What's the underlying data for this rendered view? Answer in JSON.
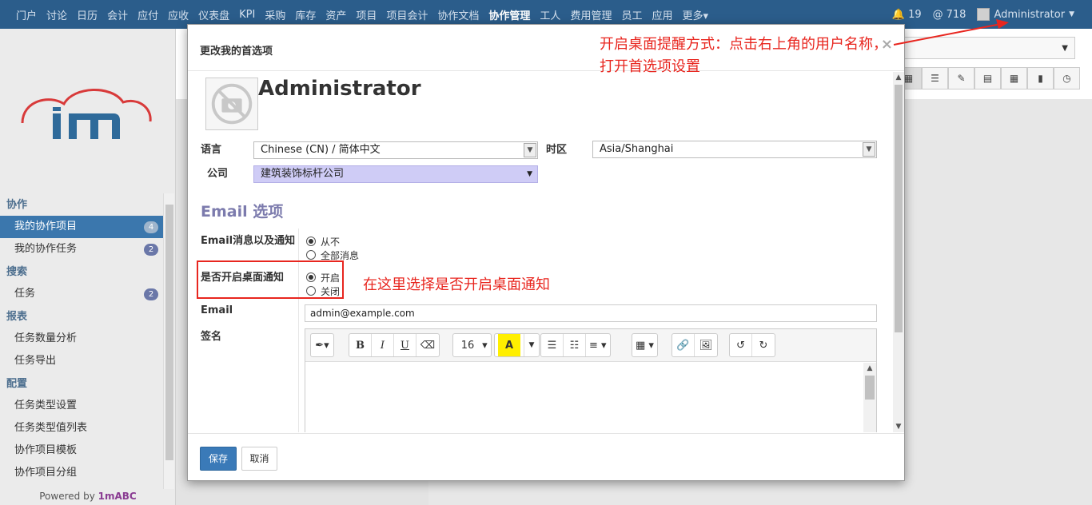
{
  "topnav": {
    "items": [
      "门户",
      "讨论",
      "日历",
      "会计",
      "应付",
      "应收",
      "仪表盘",
      "KPI",
      "采购",
      "库存",
      "资产",
      "项目",
      "项目会计",
      "协作文档",
      "协作管理",
      "工人",
      "费用管理",
      "员工",
      "应用",
      "更多▾"
    ],
    "active_index": 14,
    "notifications": "19",
    "mentions": "718",
    "user": "Administrator",
    "colors": {
      "bar": "#2b5d8b"
    }
  },
  "sidebar": {
    "sections": [
      {
        "title": "协作",
        "items": [
          {
            "label": "我的协作项目",
            "badge": "4",
            "active": true
          },
          {
            "label": "我的协作任务",
            "badge": "2"
          }
        ]
      },
      {
        "title": "搜索",
        "items": [
          {
            "label": "任务",
            "badge": "2"
          }
        ]
      },
      {
        "title": "报表",
        "items": [
          {
            "label": "任务数量分析"
          },
          {
            "label": "任务导出"
          }
        ]
      },
      {
        "title": "配置",
        "items": [
          {
            "label": "任务类型设置"
          },
          {
            "label": "任务类型值列表"
          },
          {
            "label": "协作项目模板"
          },
          {
            "label": "协作项目分组"
          }
        ]
      }
    ],
    "powered_prefix": "Powered by",
    "powered_brand": "1mABC"
  },
  "dialog": {
    "title": "更改我的首选项",
    "user_name": "Administrator",
    "language_label": "语言",
    "language_value": "Chinese (CN) / 简体中文",
    "timezone_label": "时区",
    "timezone_value": "Asia/Shanghai",
    "company_label": "公司",
    "company_value": "建筑装饰标杆公司",
    "email_section_title": "Email 选项",
    "email_notif_label": "Email消息以及通知",
    "email_notif_options": [
      {
        "label": "从不",
        "selected": true
      },
      {
        "label": "全部消息",
        "selected": false
      }
    ],
    "desktop_notif_label": "是否开启桌面通知",
    "desktop_notif_options": [
      {
        "label": "开启",
        "selected": true
      },
      {
        "label": "关闭",
        "selected": false
      }
    ],
    "email_label": "Email",
    "email_value": "admin@example.com",
    "signature_label": "签名",
    "font_size": "16",
    "save_label": "保存",
    "cancel_label": "取消"
  },
  "annotations": {
    "top_right": "开启桌面提醒方式：点击右上角的用户名称，打开首选项设置",
    "radio": "在这里选择是否开启桌面通知",
    "color": "#e8261f"
  }
}
